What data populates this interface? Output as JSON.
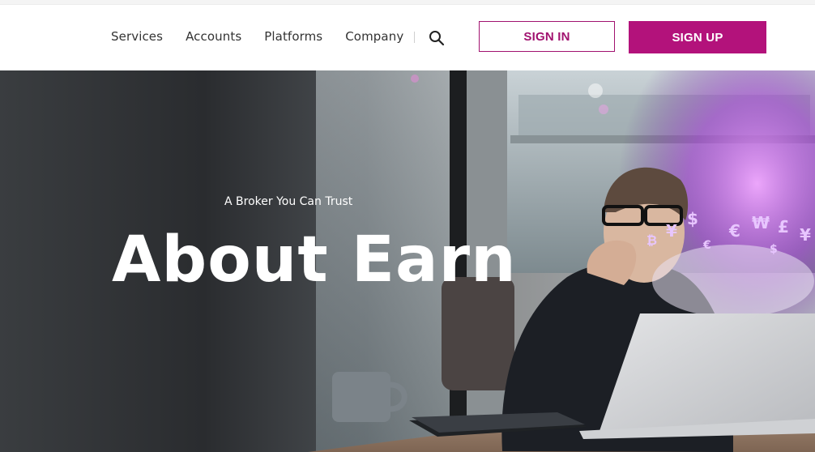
{
  "nav": {
    "items": [
      {
        "label": "Services"
      },
      {
        "label": "Accounts"
      },
      {
        "label": "Platforms"
      },
      {
        "label": "Company"
      }
    ],
    "search_icon": "search-icon"
  },
  "auth": {
    "sign_in_label": "SIGN IN",
    "sign_up_label": "SIGN UP"
  },
  "hero": {
    "kicker": "A Broker You Can Trust",
    "title": "About Earn",
    "currency_symbols": [
      "$",
      "¥",
      "€",
      "₩",
      "£",
      "¥",
      "₿",
      "€",
      "$"
    ]
  },
  "colors": {
    "brand": "#b3127b",
    "brand_outline": "#a1126f",
    "text": "#333333"
  }
}
